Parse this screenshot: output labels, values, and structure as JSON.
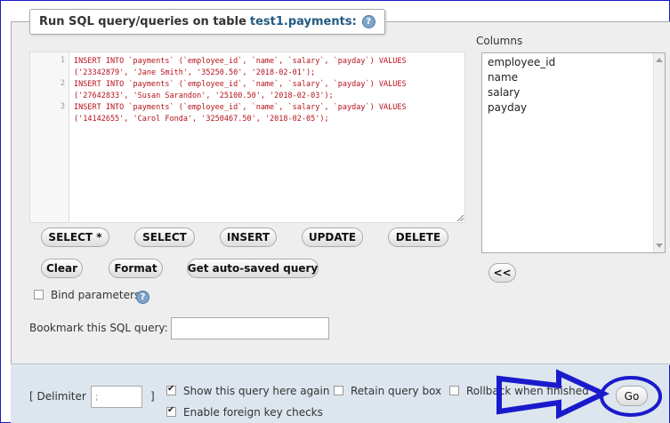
{
  "query_panel": {
    "title_prefix": "Run SQL query/queries on table",
    "table_name": "test1.payments:",
    "help_glyph": "?"
  },
  "editor": {
    "line_numbers": [
      "1",
      "2",
      "3"
    ],
    "lines": [
      "INSERT INTO `payments` (`employee_id`, `name`, `salary`, `payday`) VALUES",
      "('23342879', 'Jane Smith', '35250.50', '2018-02-01');",
      "INSERT INTO `payments` (`employee_id`, `name`, `salary`, `payday`) VALUES",
      "('27642833', 'Susan Sarandon', '25100.50', '2018-02-03');",
      "INSERT INTO `payments` (`employee_id`, `name`, `salary`, `payday`) VALUES",
      "('14142655', 'Carol Fonda', '3250467.50', '2018-02-05');"
    ]
  },
  "columns_panel": {
    "label": "Columns",
    "items": [
      "employee_id",
      "name",
      "salary",
      "payday"
    ],
    "insert_button": "<<"
  },
  "buttons": {
    "select_star": "SELECT *",
    "select": "SELECT",
    "insert": "INSERT",
    "update": "UPDATE",
    "delete": "DELETE",
    "clear": "Clear",
    "format": "Format",
    "autosaved": "Get auto-saved query"
  },
  "options": {
    "bind_parameters": "Bind parameters",
    "bookmark_label": "Bookmark this SQL query:",
    "bookmark_value": ""
  },
  "footer": {
    "delimiter_open": "[ Delimiter",
    "delimiter_value": ";",
    "delimiter_close": "]",
    "show_query": "Show this query here again",
    "retain_box": "Retain query box",
    "rollback": "Rollback when finished",
    "foreign_keys": "Enable foreign key checks",
    "go_button": "Go"
  },
  "colors": {
    "annotation": "#1a1acc",
    "accent_table_name": "#235a81"
  }
}
